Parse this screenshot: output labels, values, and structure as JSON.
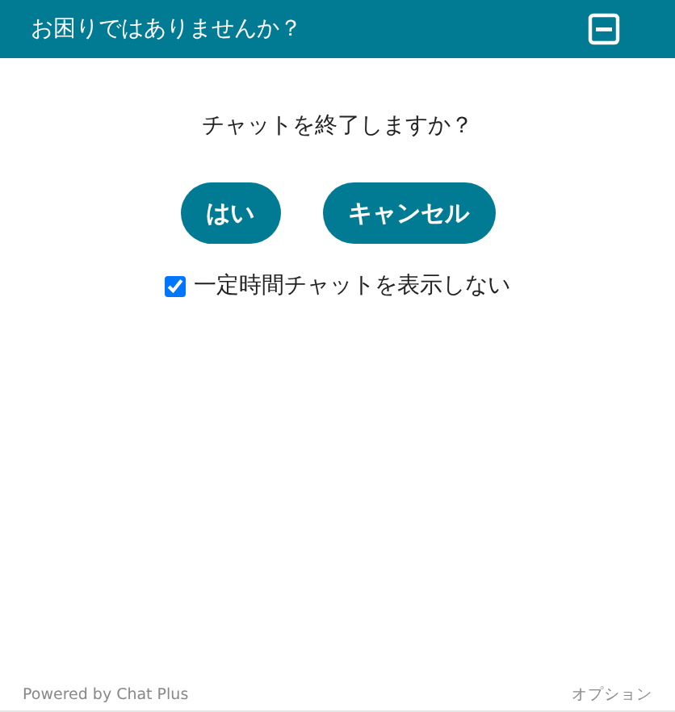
{
  "header": {
    "title": "お困りではありませんか？"
  },
  "dialog": {
    "question": "チャットを終了しますか？",
    "buttons": [
      "はい",
      "キャンセル"
    ],
    "checkbox": {
      "label": "一定時間チャットを表示しない",
      "checked": true
    }
  },
  "footer": {
    "powered_by": "Powered by Chat Plus",
    "options": "オプション"
  }
}
